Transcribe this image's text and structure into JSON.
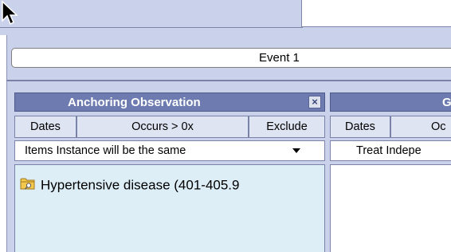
{
  "event": {
    "label": "Event 1"
  },
  "anchoring_box": {
    "title": "Anchoring Observation",
    "close_icon": "close-icon",
    "columns": {
      "dates": "Dates",
      "occurs": "Occurs > 0x",
      "exclude": "Exclude"
    },
    "instance_select": "Items Instance will be the same",
    "items": [
      {
        "label": "Hypertensive disease (401-405.9",
        "icon": "folder-icon"
      }
    ]
  },
  "second_box": {
    "title_fragment": "G",
    "columns": {
      "dates": "Dates",
      "occurs_fragment": "Oc"
    },
    "instance_select_fragment": "Treat Indepe"
  },
  "colors": {
    "panel_bg": "#c9d2ea",
    "header_bg": "#6d7bb0",
    "column_bg": "#dfe4f2",
    "list_bg": "#ddeef6"
  }
}
